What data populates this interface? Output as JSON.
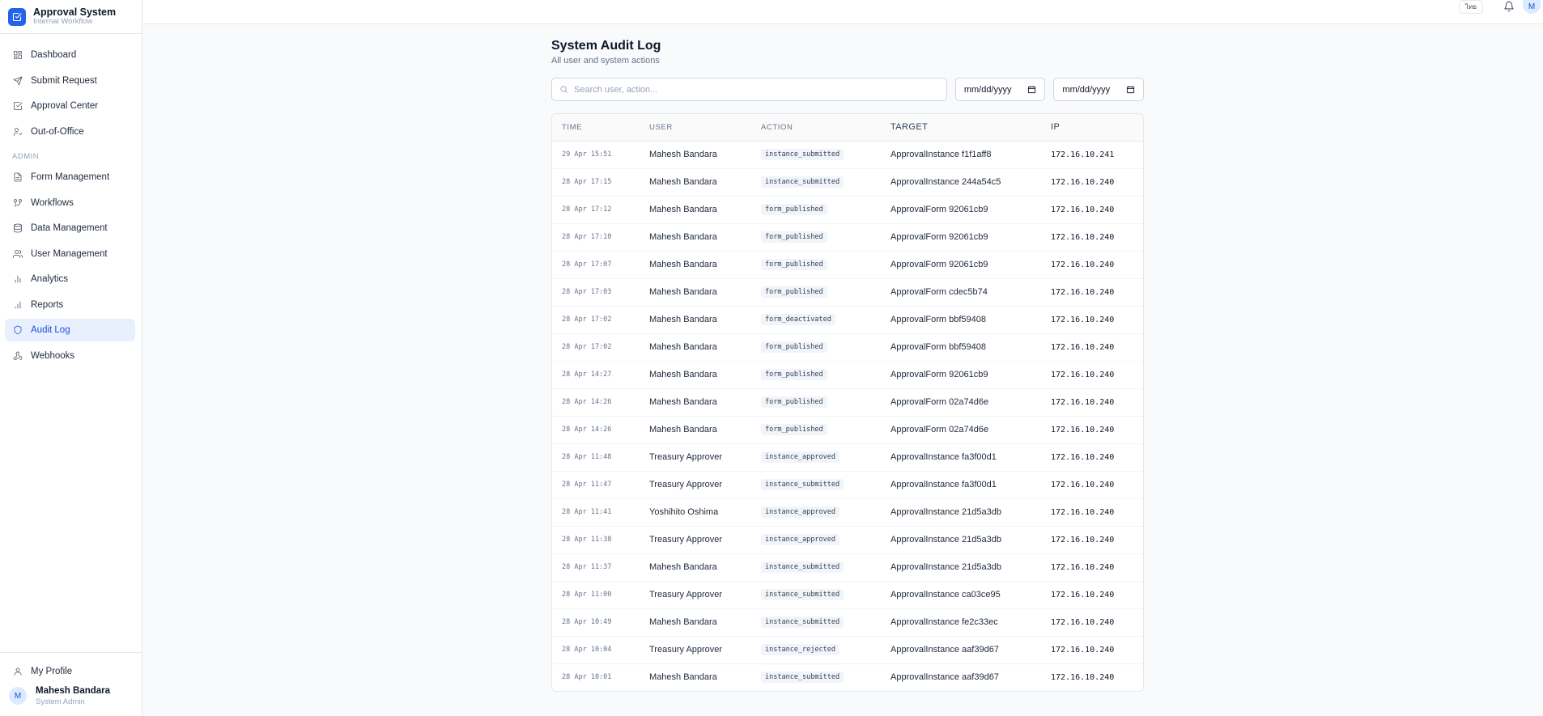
{
  "app": {
    "title": "Approval System",
    "subtitle": "Internal Workflow"
  },
  "sidebar": {
    "items": [
      {
        "label": "Dashboard",
        "icon": "dashboard-icon"
      },
      {
        "label": "Submit Request",
        "icon": "send-icon"
      },
      {
        "label": "Approval Center",
        "icon": "check-square-icon"
      },
      {
        "label": "Out-of-Office",
        "icon": "user-away-icon"
      }
    ],
    "admin_label": "ADMIN",
    "admin_items": [
      {
        "label": "Form Management",
        "icon": "file-icon"
      },
      {
        "label": "Workflows",
        "icon": "workflow-icon"
      },
      {
        "label": "Data Management",
        "icon": "database-icon"
      },
      {
        "label": "User Management",
        "icon": "users-icon"
      },
      {
        "label": "Analytics",
        "icon": "bar-chart-icon"
      },
      {
        "label": "Reports",
        "icon": "reports-icon"
      },
      {
        "label": "Audit Log",
        "icon": "shield-icon",
        "active": true
      },
      {
        "label": "Webhooks",
        "icon": "webhook-icon"
      }
    ],
    "profile_label": "My Profile",
    "user": {
      "initial": "M",
      "name": "Mahesh Bandara",
      "role": "System Admin"
    }
  },
  "topbar": {
    "lang_button": "ไทย",
    "avatar_initial": "M"
  },
  "page": {
    "title": "System Audit Log",
    "subtitle": "All user and system actions",
    "search_placeholder": "Search user, action...",
    "date_from": "mm/dd/yyyy",
    "date_to": "mm/dd/yyyy"
  },
  "table": {
    "headers": {
      "time": "TIME",
      "user": "USER",
      "action": "ACTION",
      "target": "TARGET",
      "ip": "IP"
    },
    "rows": [
      {
        "time": "29 Apr 15:51",
        "user": "Mahesh Bandara",
        "action": "instance_submitted",
        "target": "ApprovalInstance f1f1aff8",
        "ip": "172.16.10.241"
      },
      {
        "time": "28 Apr 17:15",
        "user": "Mahesh Bandara",
        "action": "instance_submitted",
        "target": "ApprovalInstance 244a54c5",
        "ip": "172.16.10.240"
      },
      {
        "time": "28 Apr 17:12",
        "user": "Mahesh Bandara",
        "action": "form_published",
        "target": "ApprovalForm 92061cb9",
        "ip": "172.16.10.240"
      },
      {
        "time": "28 Apr 17:10",
        "user": "Mahesh Bandara",
        "action": "form_published",
        "target": "ApprovalForm 92061cb9",
        "ip": "172.16.10.240"
      },
      {
        "time": "28 Apr 17:07",
        "user": "Mahesh Bandara",
        "action": "form_published",
        "target": "ApprovalForm 92061cb9",
        "ip": "172.16.10.240"
      },
      {
        "time": "28 Apr 17:03",
        "user": "Mahesh Bandara",
        "action": "form_published",
        "target": "ApprovalForm cdec5b74",
        "ip": "172.16.10.240"
      },
      {
        "time": "28 Apr 17:02",
        "user": "Mahesh Bandara",
        "action": "form_deactivated",
        "target": "ApprovalForm bbf59408",
        "ip": "172.16.10.240"
      },
      {
        "time": "28 Apr 17:02",
        "user": "Mahesh Bandara",
        "action": "form_published",
        "target": "ApprovalForm bbf59408",
        "ip": "172.16.10.240"
      },
      {
        "time": "28 Apr 14:27",
        "user": "Mahesh Bandara",
        "action": "form_published",
        "target": "ApprovalForm 92061cb9",
        "ip": "172.16.10.240"
      },
      {
        "time": "28 Apr 14:26",
        "user": "Mahesh Bandara",
        "action": "form_published",
        "target": "ApprovalForm 02a74d6e",
        "ip": "172.16.10.240"
      },
      {
        "time": "28 Apr 14:26",
        "user": "Mahesh Bandara",
        "action": "form_published",
        "target": "ApprovalForm 02a74d6e",
        "ip": "172.16.10.240"
      },
      {
        "time": "28 Apr 11:48",
        "user": "Treasury Approver",
        "action": "instance_approved",
        "target": "ApprovalInstance fa3f00d1",
        "ip": "172.16.10.240"
      },
      {
        "time": "28 Apr 11:47",
        "user": "Treasury Approver",
        "action": "instance_submitted",
        "target": "ApprovalInstance fa3f00d1",
        "ip": "172.16.10.240"
      },
      {
        "time": "28 Apr 11:41",
        "user": "Yoshihito Oshima",
        "action": "instance_approved",
        "target": "ApprovalInstance 21d5a3db",
        "ip": "172.16.10.240"
      },
      {
        "time": "28 Apr 11:38",
        "user": "Treasury Approver",
        "action": "instance_approved",
        "target": "ApprovalInstance 21d5a3db",
        "ip": "172.16.10.240"
      },
      {
        "time": "28 Apr 11:37",
        "user": "Mahesh Bandara",
        "action": "instance_submitted",
        "target": "ApprovalInstance 21d5a3db",
        "ip": "172.16.10.240"
      },
      {
        "time": "28 Apr 11:00",
        "user": "Treasury Approver",
        "action": "instance_submitted",
        "target": "ApprovalInstance ca03ce95",
        "ip": "172.16.10.240"
      },
      {
        "time": "28 Apr 10:49",
        "user": "Mahesh Bandara",
        "action": "instance_submitted",
        "target": "ApprovalInstance fe2c33ec",
        "ip": "172.16.10.240"
      },
      {
        "time": "28 Apr 10:04",
        "user": "Treasury Approver",
        "action": "instance_rejected",
        "target": "ApprovalInstance aaf39d67",
        "ip": "172.16.10.240"
      },
      {
        "time": "28 Apr 10:01",
        "user": "Mahesh Bandara",
        "action": "instance_submitted",
        "target": "ApprovalInstance aaf39d67",
        "ip": "172.16.10.240"
      }
    ]
  }
}
